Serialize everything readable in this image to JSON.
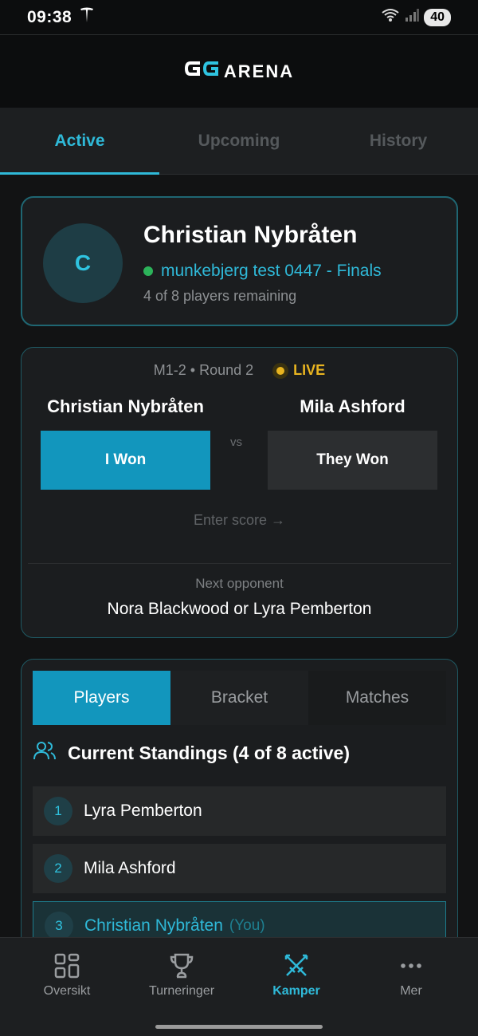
{
  "status_bar": {
    "time": "09:38",
    "battery": "40"
  },
  "header": {
    "logo_mark": "GG",
    "logo_text": "ARENA"
  },
  "top_tabs": [
    {
      "label": "Active",
      "active": true
    },
    {
      "label": "Upcoming",
      "active": false
    },
    {
      "label": "History",
      "active": false
    }
  ],
  "profile": {
    "initial": "C",
    "name": "Christian Nybråten",
    "tournament": "munkebjerg test 0447 - Finals",
    "remaining": "4 of 8 players remaining"
  },
  "match": {
    "meta": "M1-2 • Round 2",
    "live_label": "LIVE",
    "player1": "Christian Nybråten",
    "player2": "Mila Ashford",
    "vs": "vs",
    "i_won_label": "I Won",
    "they_won_label": "They Won",
    "enter_score": "Enter score →",
    "next_label": "Next opponent",
    "next_value": "Nora Blackwood or Lyra Pemberton"
  },
  "standings": {
    "tabs": [
      {
        "label": "Players",
        "active": true
      },
      {
        "label": "Bracket",
        "active": false
      },
      {
        "label": "Matches",
        "active": false
      }
    ],
    "title": "Current Standings (4 of 8 active)",
    "rows": [
      {
        "rank": "1",
        "name": "Lyra Pemberton",
        "you": false
      },
      {
        "rank": "2",
        "name": "Mila Ashford",
        "you": false
      },
      {
        "rank": "3",
        "name": "Christian Nybråten",
        "you": true,
        "you_tag": "(You)"
      }
    ]
  },
  "bottom_nav": [
    {
      "label": "Oversikt",
      "icon": "grid-icon",
      "active": false
    },
    {
      "label": "Turneringer",
      "icon": "trophy-icon",
      "active": false
    },
    {
      "label": "Kamper",
      "icon": "crossed-swords-icon",
      "active": true
    },
    {
      "label": "Mer",
      "icon": "more-icon",
      "active": false
    }
  ],
  "colors": {
    "accent": "#1296bd",
    "accent_text": "#2fb9d8",
    "live": "#e8b420",
    "online": "#2cb35a"
  }
}
